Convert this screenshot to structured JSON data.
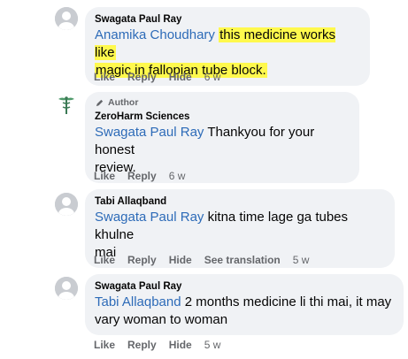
{
  "comments": [
    {
      "name": "Swagata Paul Ray",
      "mention": "Anamika Choudhary",
      "text_line1": "this medicine works like",
      "text_line2": "magic in fallopian tube block.",
      "actions": {
        "like": "Like",
        "reply": "Reply",
        "hide": "Hide",
        "time": "6 w"
      }
    },
    {
      "badge": "Author",
      "name": "ZeroHarm Sciences",
      "mention": "Swagata Paul Ray",
      "text_line1": "Thankyou for your honest",
      "text_line2": "review.",
      "actions": {
        "like": "Like",
        "reply": "Reply",
        "time": "6 w"
      }
    },
    {
      "name": "Tabi Allaqband",
      "mention": "Swagata Paul Ray",
      "text_line1": "kitna time lage ga tubes khulne",
      "text_line2": "mai",
      "actions": {
        "like": "Like",
        "reply": "Reply",
        "hide": "Hide",
        "translate": "See translation",
        "time": "5 w"
      }
    },
    {
      "name": "Swagata Paul Ray",
      "mention": "Tabi Allaqband",
      "text_line1": "2 months medicine li thi mai, it may",
      "text_line2": "vary woman to woman",
      "actions": {
        "like": "Like",
        "reply": "Reply",
        "hide": "Hide",
        "time": "5 w"
      }
    }
  ],
  "colors": {
    "mention": "#2d6bb8",
    "highlight": "#fff94d",
    "bubble": "#f0f2f5",
    "muted": "#65676b"
  },
  "icons": {
    "avatar_default": "person-silhouette-icon",
    "author_badge": "pen-icon",
    "page_logo": "caduceus-logo-icon"
  }
}
